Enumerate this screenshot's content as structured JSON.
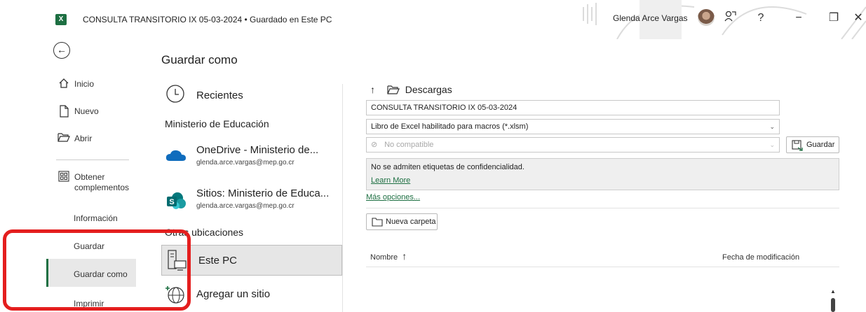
{
  "titlebar": {
    "app_icon": "excel-icon",
    "document_title": "CONSULTA TRANSITORIO IX 05-03-2024 • Guardado en Este PC",
    "user_name": "Glenda Arce Vargas",
    "icons": [
      "coauthor-icon",
      "help-icon",
      "minimize-icon",
      "restore-icon",
      "close-icon"
    ],
    "help_glyph": "?",
    "minimize_glyph": "−",
    "restore_glyph": "❐",
    "close_glyph": "✕"
  },
  "nav": {
    "back_glyph": "←",
    "items": [
      {
        "label": "Inicio",
        "icon": "home-icon"
      },
      {
        "label": "Nuevo",
        "icon": "new-document-icon"
      },
      {
        "label": "Abrir",
        "icon": "open-folder-icon"
      },
      {
        "label": "Obtener",
        "label2": "complementos",
        "icon": "addins-icon"
      },
      {
        "label": "Información"
      },
      {
        "label": "Guardar"
      },
      {
        "label": "Guardar como",
        "selected": true
      },
      {
        "label": "Imprimir"
      }
    ]
  },
  "pane_title": "Guardar como",
  "locations": {
    "recientes": "Recientes",
    "org_header": "Ministerio de Educación",
    "onedrive": {
      "name": "OneDrive - Ministerio de...",
      "email": "glenda.arce.vargas@mep.go.cr"
    },
    "sites": {
      "name": "Sitios: Ministerio de Educa...",
      "email": "glenda.arce.vargas@mep.go.cr"
    },
    "other_header": "Otras ubicaciones",
    "este_pc": "Este PC",
    "add_site": "Agregar un sitio"
  },
  "save": {
    "path_label": "Descargas",
    "filename": "CONSULTA TRANSITORIO IX 05-03-2024",
    "filetype": "Libro de Excel habilitado para macros (*.xlsm)",
    "sensitivity": "No compatible",
    "save_button": "Guardar",
    "info_message": "No se admiten etiquetas de confidencialidad.",
    "learn_more": "Learn More",
    "more_options": "Más opciones...",
    "new_folder": "Nueva carpeta",
    "col_name": "Nombre",
    "col_name_sort": "↑",
    "col_modified": "Fecha de modificación"
  },
  "colors": {
    "excel_green": "#1d6f42",
    "highlight_red": "#e41e1e"
  }
}
